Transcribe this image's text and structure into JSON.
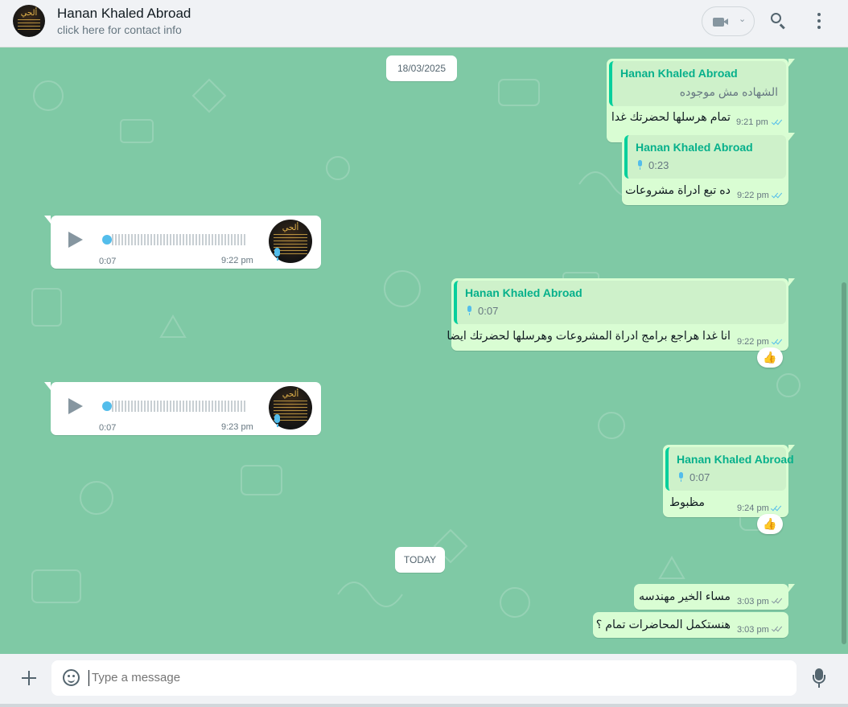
{
  "header": {
    "contact_name": "Hanan Khaled Abroad",
    "subtitle": "click here for contact info",
    "avatar_mark": "ألحي"
  },
  "date_separators": {
    "first": "18/03/2025",
    "today": "TODAY"
  },
  "messages": {
    "m1": {
      "quote_name": "Hanan Khaled Abroad",
      "quote_text": "الشهاده مش موجوده",
      "text": "تمام هرسلها لحضرتك غدا",
      "time": "9:21 pm",
      "status": "read"
    },
    "m2": {
      "quote_name": "Hanan Khaled Abroad",
      "quote_duration": "0:23",
      "text": "ده تبع ادراة مشروعات",
      "time": "9:22 pm",
      "status": "read"
    },
    "v1": {
      "duration": "0:07",
      "time": "9:22 pm",
      "progress": 0
    },
    "m3": {
      "quote_name": "Hanan Khaled Abroad",
      "quote_duration": "0:07",
      "text": "انا غدا هراجع برامج ادراة المشروعات وهرسلها لحضرتك ايضا",
      "time": "9:22 pm",
      "status": "read",
      "reaction": "👍"
    },
    "v2": {
      "duration": "0:07",
      "time": "9:23 pm",
      "progress": 0
    },
    "m4": {
      "quote_name": "Hanan Khaled Abroad",
      "quote_duration": "0:07",
      "text": "مظبوط",
      "time": "9:24 pm",
      "status": "read",
      "reaction": "👍"
    },
    "m5": {
      "text": "مساء الخير مهندسه",
      "time": "3:03 pm",
      "status": "delivered"
    },
    "m6": {
      "text": "هنستكمل المحاضرات تمام ؟",
      "time": "3:03 pm",
      "status": "delivered"
    }
  },
  "composer": {
    "placeholder": "Type a message"
  },
  "icons": {
    "video": "video-camera-icon",
    "search": "search-icon",
    "menu": "menu-dots-icon",
    "attach": "plus-icon",
    "sticker": "sticker-icon",
    "mic": "microphone-icon",
    "play": "play-icon"
  },
  "colors": {
    "chat_background": "#7fc9a5",
    "outgoing_bubble": "#d9fdd3",
    "incoming_bubble": "#ffffff",
    "quote_accent": "#06cf9c",
    "read_ticks": "#53bdeb"
  }
}
